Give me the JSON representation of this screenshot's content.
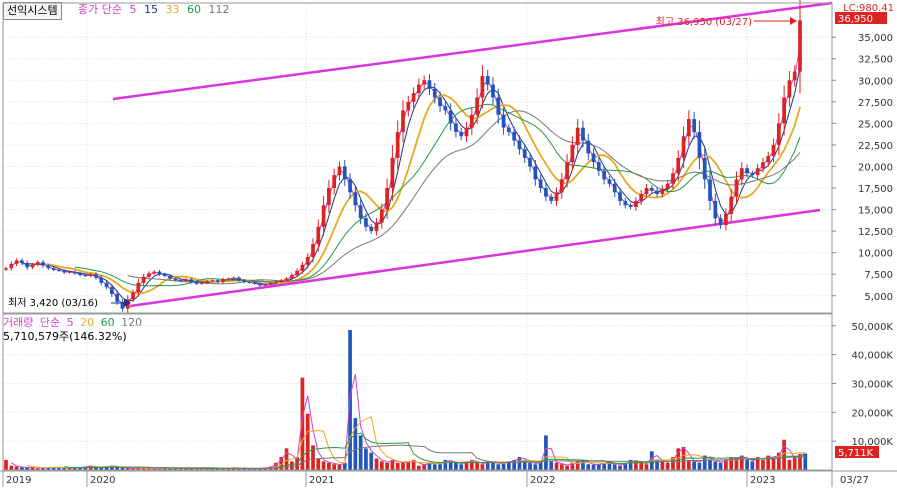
{
  "stock": {
    "name": "선익시스템"
  },
  "price_legend": {
    "label": "종가 단순",
    "periods": [
      {
        "value": "5",
        "color": "#cc44cc"
      },
      {
        "value": "15",
        "color": "#223388"
      },
      {
        "value": "33",
        "color": "#e8a820"
      },
      {
        "value": "60",
        "color": "#229944"
      },
      {
        "value": "112",
        "color": "#777777"
      }
    ]
  },
  "volume_legend": {
    "title": "거래량",
    "label": "단순",
    "periods": [
      {
        "value": "5",
        "color": "#cc44cc"
      },
      {
        "value": "20",
        "color": "#e8a820"
      },
      {
        "value": "60",
        "color": "#229944"
      },
      {
        "value": "120",
        "color": "#777777"
      }
    ],
    "stat": "5,710,579주(146.32%)"
  },
  "annotations": {
    "high_text": "최고 36,950 (03/27)",
    "low_text": "최저 3,420 (03/16)",
    "lc_text": "LC:980.41",
    "current_price": "36,950",
    "current_volume": "5,711K",
    "date_end": "03/27"
  },
  "colors": {
    "up": "#dd2222",
    "down": "#2255bb",
    "channel": "#dd33dd",
    "price_tag_bg": "#dd2222",
    "grid": "#dcdcdc"
  },
  "chart_data": [
    {
      "type": "candlestick",
      "title": "선익시스템",
      "x_labels": [
        "2019",
        "2020",
        "2021",
        "2022",
        "2023"
      ],
      "y_ticks": [
        "5,000",
        "7,500",
        "10,000",
        "12,500",
        "15,000",
        "17,500",
        "20,000",
        "22,500",
        "25,000",
        "27,500",
        "30,000",
        "32,500",
        "35,000"
      ],
      "ylim": [
        3000,
        38500
      ],
      "grid": true,
      "weekly_close": [
        8200,
        8700,
        9100,
        8800,
        8300,
        8600,
        8900,
        8500,
        8200,
        8000,
        7900,
        7700,
        7800,
        7600,
        7400,
        7300,
        7500,
        7100,
        6500,
        6000,
        5200,
        4300,
        3500,
        4600,
        5400,
        6500,
        7200,
        7600,
        7800,
        7500,
        7300,
        7000,
        6800,
        6700,
        6900,
        6600,
        6400,
        6500,
        6700,
        6800,
        6600,
        6900,
        7000,
        7100,
        6800,
        6600,
        6500,
        6400,
        6200,
        6300,
        6500,
        6600,
        6800,
        7000,
        7400,
        7900,
        8600,
        9500,
        11000,
        13000,
        15500,
        17500,
        19000,
        20000,
        18500,
        17000,
        15500,
        14000,
        13000,
        12500,
        13500,
        15000,
        17500,
        21000,
        24000,
        26500,
        27500,
        28500,
        29500,
        30000,
        29000,
        28000,
        27000,
        26500,
        25000,
        24000,
        23500,
        24500,
        26000,
        28000,
        30500,
        29500,
        28000,
        26000,
        24500,
        24000,
        23000,
        22000,
        21000,
        20000,
        18500,
        17500,
        16500,
        16000,
        17000,
        18500,
        20500,
        22500,
        24500,
        23000,
        21500,
        20500,
        19500,
        18500,
        18000,
        17000,
        16000,
        15500,
        15300,
        16000,
        16800,
        17500,
        17200,
        16800,
        17400,
        18000,
        19200,
        21000,
        23500,
        25500,
        24000,
        21000,
        18500,
        16000,
        14000,
        13200,
        14500,
        16500,
        18500,
        19800,
        19200,
        19000,
        19800,
        20500,
        21200,
        22500,
        25000,
        28000,
        30000,
        31000,
        36950
      ],
      "weekly_volume_k": [
        3500,
        1500,
        1200,
        900,
        800,
        1100,
        600,
        700,
        900,
        800,
        1000,
        700,
        600,
        800,
        900,
        1200,
        1500,
        900,
        800,
        1300,
        1500,
        1000,
        800,
        600,
        500,
        900,
        700,
        600,
        400,
        500,
        600,
        700,
        500,
        500,
        600,
        400,
        500,
        600,
        400,
        500,
        600,
        500,
        700,
        800,
        600,
        500,
        400,
        500,
        600,
        800,
        1200,
        2500,
        4500,
        7500,
        3000,
        4500,
        32000,
        19500,
        8500,
        4000,
        3000,
        2500,
        2000,
        1800,
        2500,
        48500,
        18000,
        12000,
        7500,
        6000,
        4000,
        3000,
        2500,
        3500,
        2500,
        2500,
        3000,
        3500,
        1500,
        2000,
        2500,
        2000,
        2500,
        3500,
        3000,
        2500,
        2000,
        3000,
        3500,
        2500,
        2000,
        3000,
        2500,
        2000,
        2500,
        3000,
        3500,
        4500,
        3500,
        2500,
        2000,
        3000,
        12000,
        3000,
        2500,
        2000,
        1500,
        2500,
        3000,
        3500,
        2000,
        1800,
        2000,
        2500,
        3000,
        2000,
        1500,
        2500,
        3500,
        3000,
        2500,
        2000,
        6500,
        3500,
        3000,
        2500,
        4500,
        7500,
        8000,
        3500,
        3000,
        2500,
        5000,
        4000,
        3000,
        2500,
        3500,
        4500,
        4000,
        5000,
        3500,
        3000,
        4500,
        3500,
        5000,
        4000,
        6000,
        10500,
        3500,
        4500,
        5500,
        5711
      ],
      "volume_ticks": [
        "10,000K",
        "20,000K",
        "30,000K",
        "40,000K",
        "50,000K"
      ],
      "volume_ylim": [
        0,
        52000
      ],
      "highlight": {
        "high": 36950,
        "low": 3420
      }
    }
  ]
}
